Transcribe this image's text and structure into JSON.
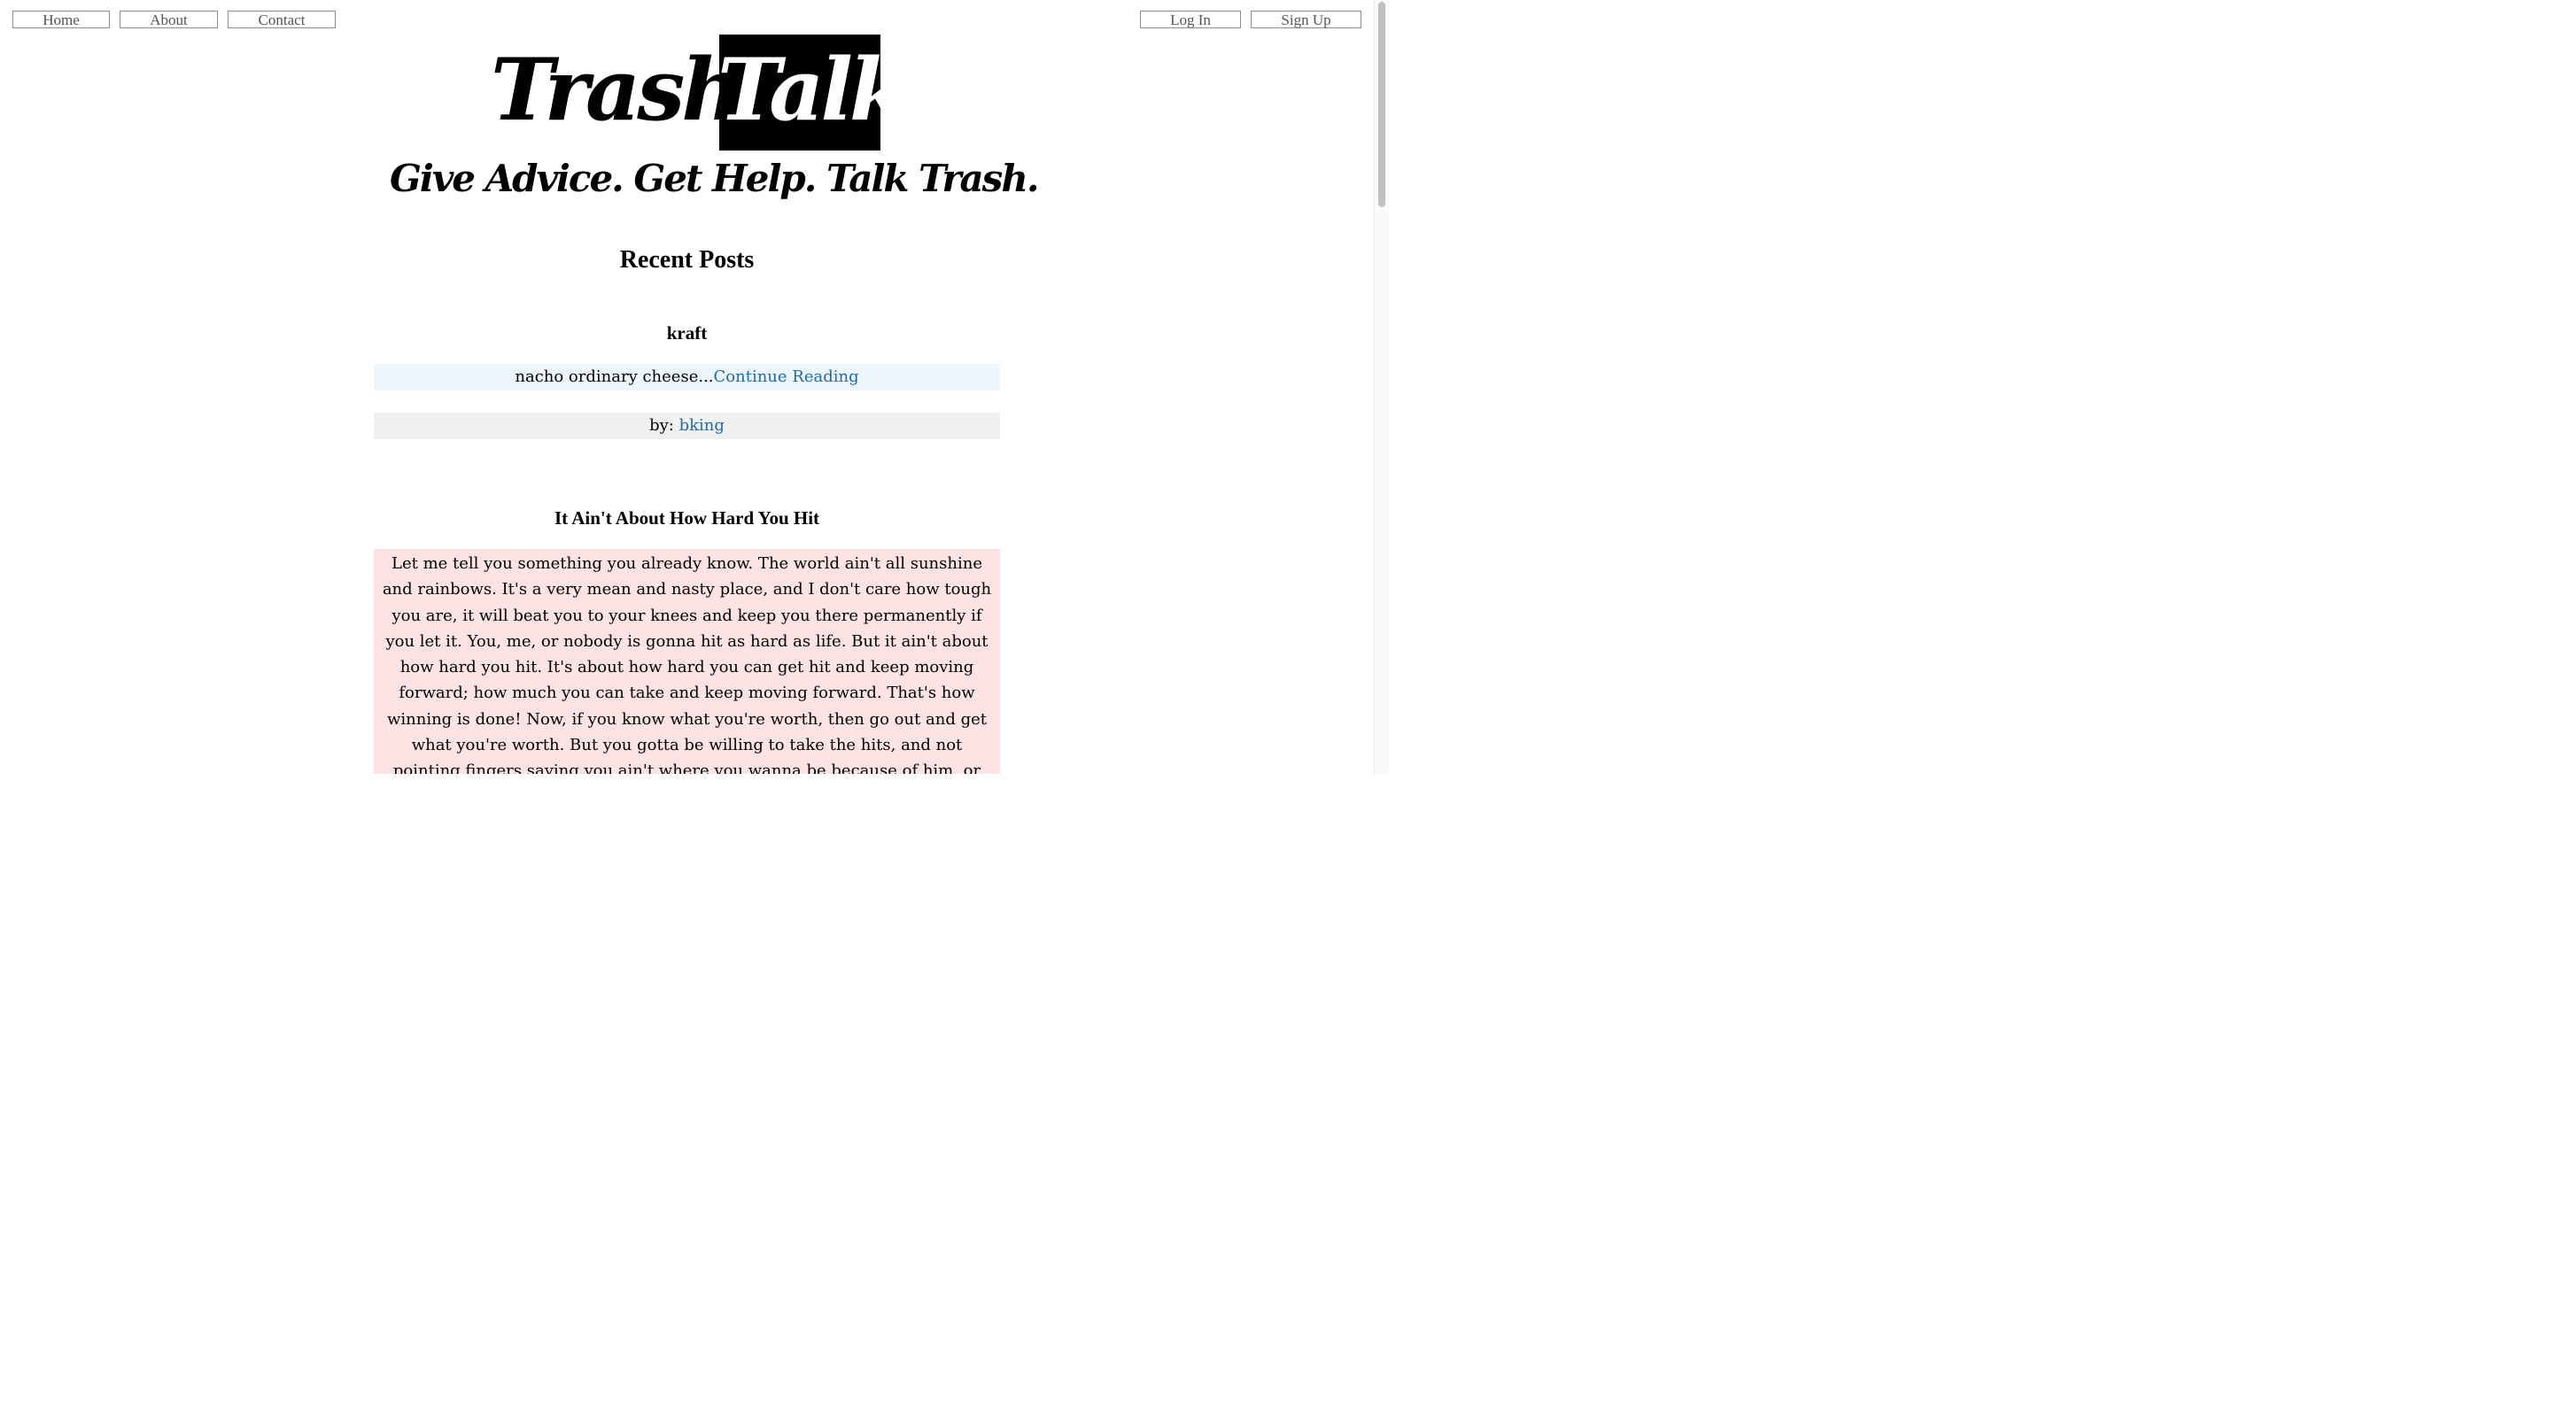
{
  "nav": {
    "home": "Home",
    "about": "About",
    "contact": "Contact",
    "login": "Log In",
    "signup": "Sign Up"
  },
  "logo": {
    "word1": "Trash",
    "word2": "Talk"
  },
  "tagline": "Give Advice. Get Help. Talk Trash.",
  "section_title": "Recent Posts",
  "posts": [
    {
      "title": "kraft",
      "excerpt": "nacho ordinary cheese...",
      "continue_label": "Continue Reading",
      "by_label": "by: ",
      "author": "bking",
      "body_bg": "#eef6fd"
    },
    {
      "title": "It Ain't About How Hard You Hit",
      "body": "Let me tell you something you already know. The world ain't all sunshine and rainbows. It's a very mean and nasty place, and I don't care how tough you are, it will beat you to your knees and keep you there permanently if you let it. You, me, or nobody is gonna hit as hard as life. But it ain't about how hard you hit. It's about how hard you can get hit and keep moving forward; how much you can take and keep moving forward. That's how winning is done! Now, if you know what you're worth, then go out and get what you're worth. But you gotta be willing to take the hits, and not pointing fingers saying you ain't where you wanna be because of him, or her, or anybody. Cowards do that and that ain't you. You're better than that! I'm always gonna",
      "body_bg": "#fde3e4"
    }
  ],
  "colors": {
    "link": "#1f6aa8",
    "byline_bg": "#f0f0f0"
  }
}
